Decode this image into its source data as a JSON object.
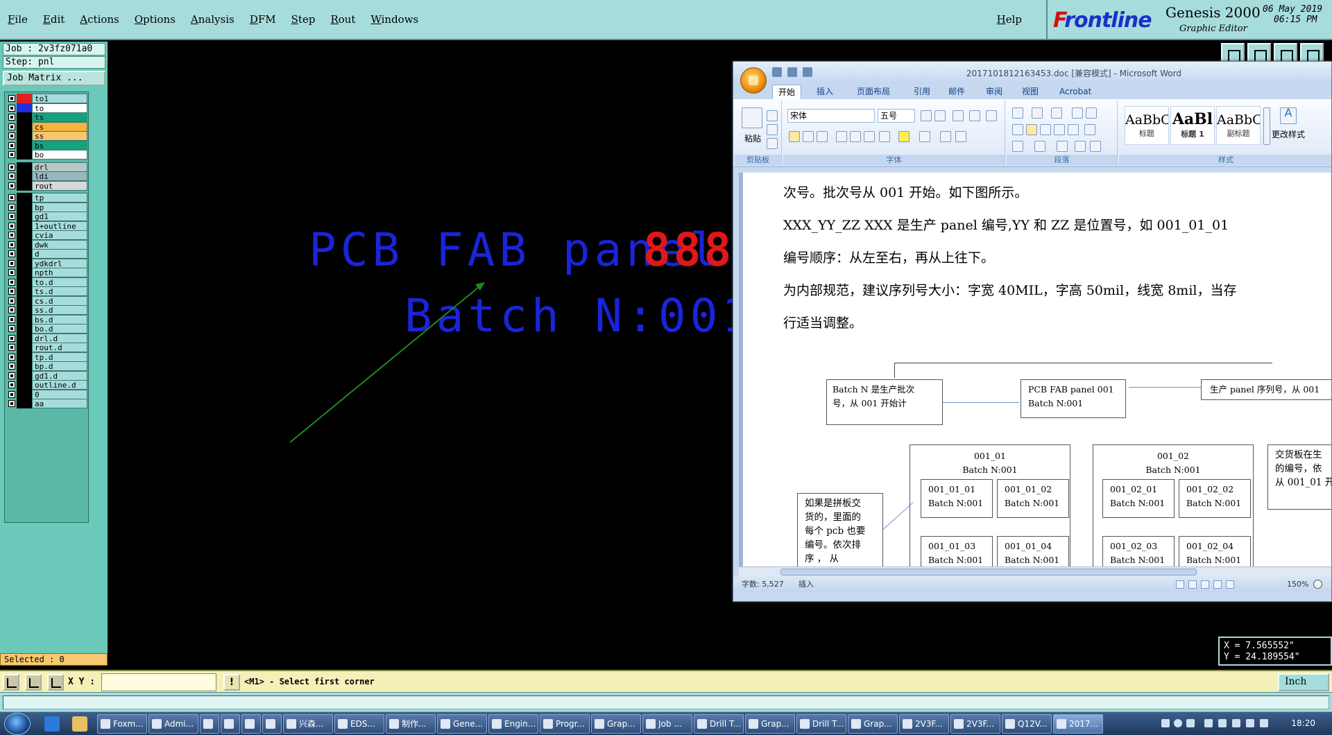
{
  "menu": [
    "File",
    "Edit",
    "Actions",
    "Options",
    "Analysis",
    "DFM",
    "Step",
    "Rout",
    "Windows"
  ],
  "help": "Help",
  "brand": {
    "logo_f": "F",
    "logo_rest": "rontline",
    "product": "Genesis 2000",
    "subtitle": "Graphic Editor",
    "date": "06 May 2019",
    "time": "06:15 PM"
  },
  "job": "Job : 2v3fz071a0",
  "step": "Step: pnl",
  "job_matrix": "Job Matrix ...",
  "layers": [
    {
      "name": "to1",
      "swatch": "#e02020",
      "bg": "#a7dcdc"
    },
    {
      "name": "to",
      "swatch": "#2030e0",
      "bg": "#ffffff"
    },
    {
      "name": "ts",
      "swatch": "#000000",
      "bg": "#14a37f"
    },
    {
      "name": "cs",
      "swatch": "#000000",
      "bg": "#f7b33e"
    },
    {
      "name": "ss",
      "swatch": "#000000",
      "bg": "#f7c86e"
    },
    {
      "name": "bs",
      "swatch": "#000000",
      "bg": "#14a37f"
    },
    {
      "name": "bo",
      "swatch": "#000000",
      "bg": "#ffffff"
    },
    {
      "name": "drl",
      "swatch": "#000000",
      "bg": "#b8c8c8"
    },
    {
      "name": "ldi",
      "swatch": "#000000",
      "bg": "#98b8c0"
    },
    {
      "name": "rout",
      "swatch": "#000000",
      "bg": "#d8d8d8"
    },
    {
      "name": "tp",
      "swatch": "#000000",
      "bg": "#a7dcdc"
    },
    {
      "name": "bp",
      "swatch": "#000000",
      "bg": "#a7dcdc"
    },
    {
      "name": "gd1",
      "swatch": "#000000",
      "bg": "#a7dcdc"
    },
    {
      "name": "1+outline",
      "swatch": "#000000",
      "bg": "#a7dcdc"
    },
    {
      "name": "cvia",
      "swatch": "#000000",
      "bg": "#a7dcdc"
    },
    {
      "name": "dwk",
      "swatch": "#000000",
      "bg": "#a7dcdc"
    },
    {
      "name": "d",
      "swatch": "#000000",
      "bg": "#a7dcdc"
    },
    {
      "name": "ydkdrl",
      "swatch": "#000000",
      "bg": "#a7dcdc"
    },
    {
      "name": "npth",
      "swatch": "#000000",
      "bg": "#a7dcdc"
    },
    {
      "name": "to.d",
      "swatch": "#000000",
      "bg": "#a7dcdc"
    },
    {
      "name": "ts.d",
      "swatch": "#000000",
      "bg": "#a7dcdc"
    },
    {
      "name": "cs.d",
      "swatch": "#000000",
      "bg": "#a7dcdc"
    },
    {
      "name": "ss.d",
      "swatch": "#000000",
      "bg": "#a7dcdc"
    },
    {
      "name": "bs.d",
      "swatch": "#000000",
      "bg": "#a7dcdc"
    },
    {
      "name": "bo.d",
      "swatch": "#000000",
      "bg": "#a7dcdc"
    },
    {
      "name": "drl.d",
      "swatch": "#000000",
      "bg": "#a7dcdc"
    },
    {
      "name": "rout.d",
      "swatch": "#000000",
      "bg": "#a7dcdc"
    },
    {
      "name": "tp.d",
      "swatch": "#000000",
      "bg": "#a7dcdc"
    },
    {
      "name": "bp.d",
      "swatch": "#000000",
      "bg": "#a7dcdc"
    },
    {
      "name": "gd1.d",
      "swatch": "#000000",
      "bg": "#a7dcdc"
    },
    {
      "name": "outline.d",
      "swatch": "#000000",
      "bg": "#a7dcdc"
    },
    {
      "name": "0",
      "swatch": "#000000",
      "bg": "#a7dcdc"
    },
    {
      "name": "aa",
      "swatch": "#000000",
      "bg": "#a7dcdc"
    }
  ],
  "selected": "Selected : 0",
  "canvas": {
    "line1": "PCB FAB panel",
    "digits": "888",
    "line2": "Batch N:001",
    "text_color": "#1a24d8",
    "digit_color": "#e01818",
    "arrow_color": "#1f8a1f"
  },
  "coords": {
    "x": "X = 7.565552\"",
    "y": "Y = 24.189554\""
  },
  "cmd": {
    "xy_label": "X Y :",
    "xy_value": "",
    "excl": "!",
    "message": "<M1> - Select first corner",
    "unit": "Inch"
  },
  "word": {
    "title": "2017101812163453.doc [兼容模式] - Microsoft Word",
    "tabs": [
      "开始",
      "插入",
      "页面布局",
      "引用",
      "邮件",
      "审阅",
      "视图",
      "Acrobat"
    ],
    "font_name": "宋体",
    "font_size": "五号",
    "paste": "粘贴",
    "groups": [
      "剪贴板",
      "字体",
      "段落",
      "样式"
    ],
    "styles": [
      {
        "preview": "AaBbC",
        "label": "标题"
      },
      {
        "preview": "AaBl",
        "label": "标题 1"
      },
      {
        "preview": "AaBbC",
        "label": "副标题"
      }
    ],
    "change_styles": "更改样式",
    "paragraphs": [
      "次号。批次号从 001 开始。如下图所示。",
      "XXX_YY_ZZ   XXX 是生产 panel 编号,YY 和 ZZ  是位置号，如 001_01_01",
      "编号顺序：从左至右，再从上往下。",
      "为内部规范，建议序列号大小：字宽 40MIL，字高 50mil，线宽 8mil，当存",
      "行适当调整。"
    ],
    "diagram": {
      "batch_note": [
        "Batch  N  是生产批次",
        "号，从 001 开始计"
      ],
      "center_box": [
        "PCB  FAB  panel 001",
        "Batch N:001"
      ],
      "serial_note": "生产 panel  序列号，从 001",
      "group1": [
        "001_01",
        "Batch N:001"
      ],
      "group2": [
        "001_02",
        "Batch N:001"
      ],
      "cells": [
        [
          "001_01_01",
          "Batch N:001"
        ],
        [
          "001_01_02",
          "Batch N:001"
        ],
        [
          "001_02_01",
          "Batch N:001"
        ],
        [
          "001_02_02",
          "Batch N:001"
        ],
        [
          "001_01_03",
          "Batch N:001"
        ],
        [
          "001_01_04",
          "Batch N:001"
        ],
        [
          "001_02_03",
          "Batch N:001"
        ],
        [
          "001_02_04",
          "Batch N:001"
        ]
      ],
      "left_note": [
        "如果是拼板交",
        "货的，里面的",
        "每个 pcb 也要",
        "编号。依次排",
        "序    ，  从"
      ],
      "right_note": [
        "交货板在生",
        "的编号，依",
        "从 001_01 开"
      ]
    },
    "status_words": "字数: 5,527",
    "status_mode": "插入",
    "zoom": "150%"
  },
  "taskbar": {
    "tasks": [
      "Foxm...",
      "Admi...",
      "",
      "",
      "",
      "",
      "兴森...",
      "EDS...",
      "制作...",
      "Gene...",
      "Engin...",
      "Progr...",
      "Grap...",
      "Job ...",
      "Drill T...",
      "Grap...",
      "Drill T...",
      "Grap...",
      "2V3F...",
      "2V3F...",
      "Q12V...",
      "2017..."
    ],
    "clock": "18:20"
  }
}
